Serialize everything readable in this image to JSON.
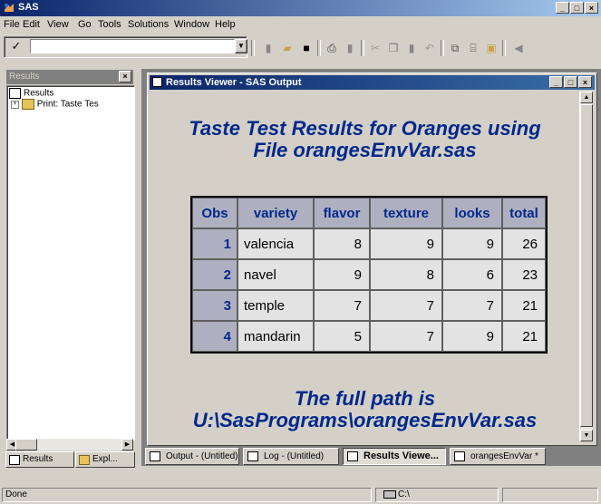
{
  "app": {
    "title": "SAS"
  },
  "menu": [
    "File",
    "Edit",
    "View",
    "Go",
    "Tools",
    "Solutions",
    "Window",
    "Help"
  ],
  "toolbar": {
    "command_value": "",
    "icons": [
      "new-icon",
      "open-icon",
      "save-icon",
      "print-icon",
      "print-preview-icon",
      "cut-icon",
      "copy-icon",
      "paste-icon",
      "undo-icon",
      "submit-icon",
      "libraries-icon",
      "explorer-icon",
      "back-icon"
    ]
  },
  "results_panel": {
    "title": "Results",
    "tree_root": "Results",
    "tree_child": "Print:  Taste Tes",
    "tabs": [
      "Results",
      "Expl..."
    ]
  },
  "viewer": {
    "title": "Results Viewer - SAS Output",
    "report_title_line1": "Taste Test Results for Oranges using",
    "report_title_line2": "File orangesEnvVar.sas",
    "table": {
      "headers": [
        "Obs",
        "variety",
        "flavor",
        "texture",
        "looks",
        "total"
      ],
      "rows": [
        [
          "1",
          "valencia",
          "8",
          "9",
          "9",
          "26"
        ],
        [
          "2",
          "navel",
          "9",
          "8",
          "6",
          "23"
        ],
        [
          "3",
          "temple",
          "7",
          "7",
          "7",
          "21"
        ],
        [
          "4",
          "mandarin",
          "5",
          "7",
          "9",
          "21"
        ]
      ]
    },
    "footer_line1": "The full path is",
    "footer_line2": "U:\\SasPrograms\\orangesEnvVar.sas"
  },
  "taskbar": [
    "Output - (Untitled)",
    "Log - (Untitled)",
    "Results Viewe...",
    "orangesEnvVar *"
  ],
  "status": {
    "text": "Done",
    "path": "C:\\"
  },
  "colors": {
    "title_blue": "#00288c",
    "header_gray": "#aeb0c0"
  }
}
